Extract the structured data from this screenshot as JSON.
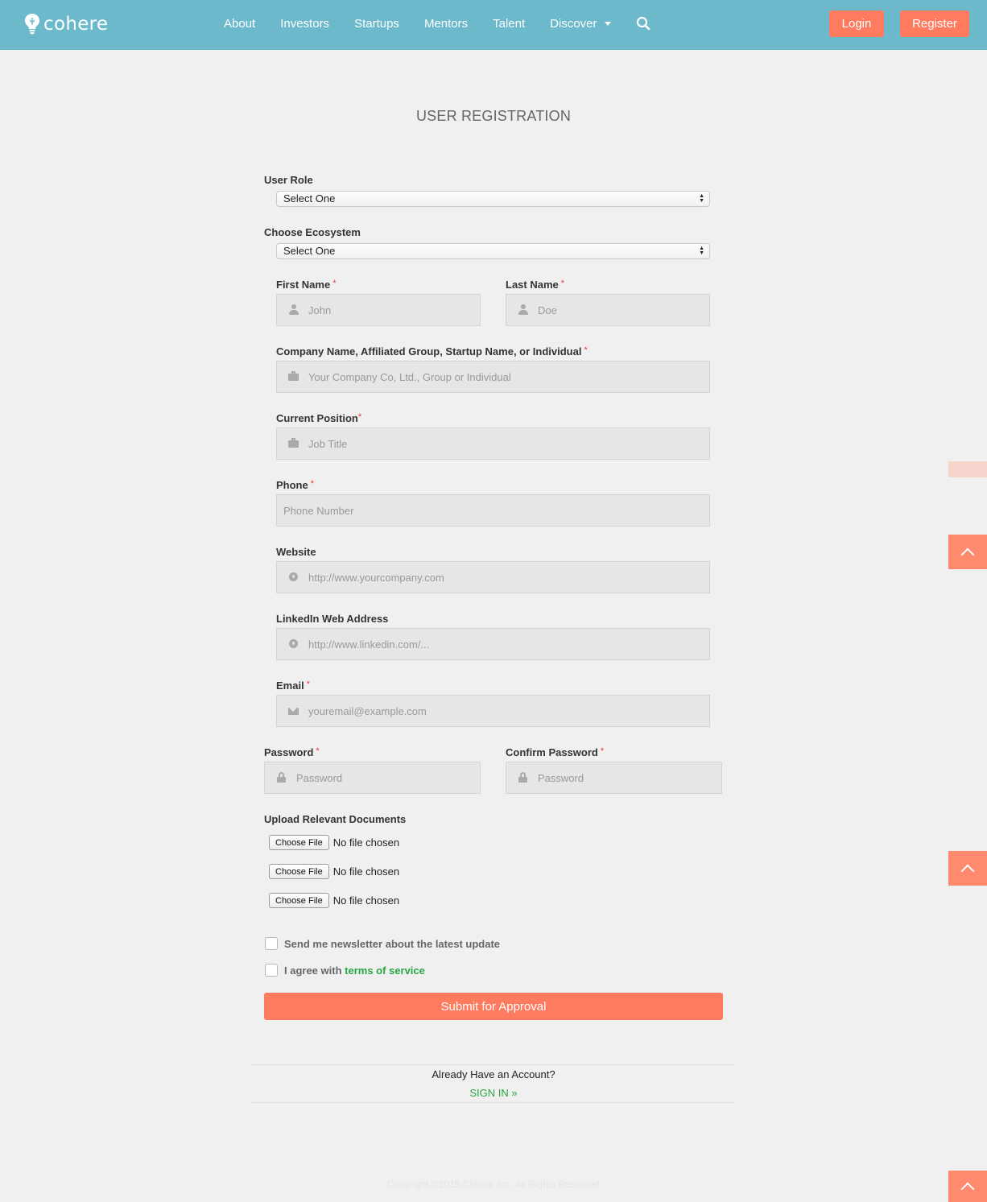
{
  "header": {
    "logo_text": "cohere",
    "nav": [
      {
        "label": "About"
      },
      {
        "label": "Investors"
      },
      {
        "label": "Startups"
      },
      {
        "label": "Mentors"
      },
      {
        "label": "Talent"
      },
      {
        "label": "Discover"
      }
    ],
    "login_label": "Login",
    "register_label": "Register"
  },
  "page": {
    "title": "USER REGISTRATION"
  },
  "form": {
    "user_role": {
      "label": "User Role",
      "value": "Select One"
    },
    "ecosystem": {
      "label": "Choose Ecosystem",
      "value": "Select One"
    },
    "first_name": {
      "label": "First Name",
      "required": "*",
      "placeholder": "John"
    },
    "last_name": {
      "label": "Last Name",
      "required": "*",
      "placeholder": "Doe"
    },
    "company": {
      "label": "Company Name, Affiliated Group, Startup Name, or Individual",
      "required": "*",
      "placeholder": "Your Company Co, Ltd., Group or Individual"
    },
    "position": {
      "label": "Current Position",
      "required": "*",
      "placeholder": "Job Title"
    },
    "phone": {
      "label": "Phone",
      "required": "*",
      "placeholder": "Phone Number"
    },
    "website": {
      "label": "Website",
      "placeholder": "http://www.yourcompany.com"
    },
    "linkedin": {
      "label": "LinkedIn Web Address",
      "placeholder": "http://www.linkedin.com/..."
    },
    "email": {
      "label": "Email",
      "required": "*",
      "placeholder": "youremail@example.com"
    },
    "password": {
      "label": "Password",
      "required": "*",
      "placeholder": "Password"
    },
    "confirm_password": {
      "label": "Confirm Password",
      "required": "*",
      "placeholder": "Password"
    },
    "uploads": {
      "label": "Upload Relevant Documents",
      "files": [
        {
          "button": "Choose File",
          "status": "No file chosen"
        },
        {
          "button": "Choose File",
          "status": "No file chosen"
        },
        {
          "button": "Choose File",
          "status": "No file chosen"
        }
      ]
    },
    "newsletter_label": "Send me newsletter about the latest update",
    "agree_prefix": "I agree with",
    "tos_link": "terms of service",
    "submit_label": "Submit for Approval"
  },
  "account": {
    "prompt": "Already Have an Account?",
    "signin_label": "SIGN IN »"
  },
  "footer": {
    "copyright": "Copyright ©2015 Cohere Inc. All Rights Reserved"
  },
  "colors": {
    "header_bg": "#6bb9cb",
    "accent": "#ff7b5f",
    "link_green": "#28a745",
    "page_bg": "#f0f0f0"
  },
  "icons": [
    "lightbulb-icon",
    "search-icon",
    "user-icon",
    "briefcase-icon",
    "globe-icon",
    "envelope-icon",
    "lock-icon",
    "chevron-up-icon"
  ]
}
